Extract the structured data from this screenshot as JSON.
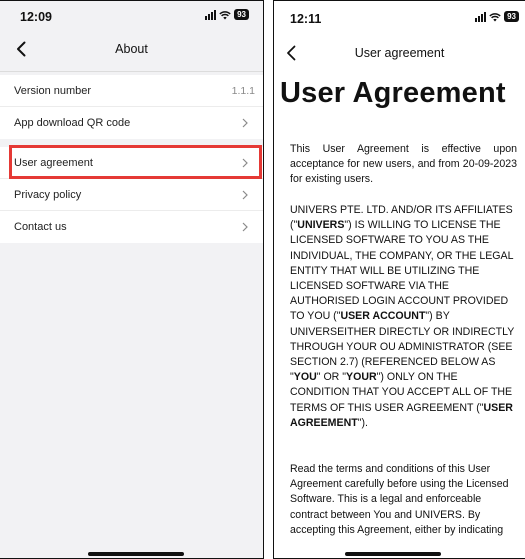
{
  "left_screen": {
    "status_time": "12:09",
    "battery": "93",
    "title": "About",
    "info_rows": [
      {
        "label": "Version number",
        "value": "1.1.1"
      },
      {
        "label": "App download QR code"
      }
    ],
    "menu_rows": [
      {
        "label": "User agreement"
      },
      {
        "label": "Privacy policy"
      },
      {
        "label": "Contact us"
      }
    ],
    "highlight_color": "#e53935"
  },
  "right_screen": {
    "status_time": "12:11",
    "battery": "93",
    "title": "User agreement",
    "heading": "User Agreement",
    "paragraph_1": "This User Agreement is effective upon acceptance for new users, and from 20-09-2023 for existing users.",
    "paragraph_2": {
      "t1": "UNIVERS PTE. LTD. AND/OR ITS AFFILIATES (\"",
      "b1": "UNIVERS",
      "t2": "\") IS WILLING TO LICENSE THE LICENSED SOFTWARE TO YOU AS THE INDIVIDUAL, THE COMPANY, OR THE LEGAL ENTITY THAT WILL BE UTILIZING THE LICENSED SOFTWARE VIA THE AUTHORISED LOGIN ACCOUNT PROVIDED TO YOU (\"",
      "b2": "USER ACCOUNT",
      "t3": "\") BY UNIVERSEITHER DIRECTLY OR INDIRECTLY THROUGH YOUR OU ADMINISTRATOR (SEE SECTION 2.7) (REFERENCED BELOW AS \"",
      "b3": "YOU",
      "t4": "\" OR \"",
      "b4": "YOUR",
      "t5": "\") ONLY ON THE CONDITION THAT YOU ACCEPT ALL OF THE TERMS OF THIS USER AGREEMENT (\"",
      "b5": "USER AGREEMENT",
      "t6": "\")."
    },
    "paragraph_3": "Read the terms and conditions of this User Agreement carefully before using the Licensed Software. This is a legal and enforceable contract between You and UNIVERS. By accepting this Agreement, either by indicating"
  },
  "icons": {
    "back": "chevron-left-icon",
    "row": "chevron-right-icon",
    "signal": "signal-icon",
    "wifi": "wifi-icon",
    "battery": "battery-icon"
  }
}
